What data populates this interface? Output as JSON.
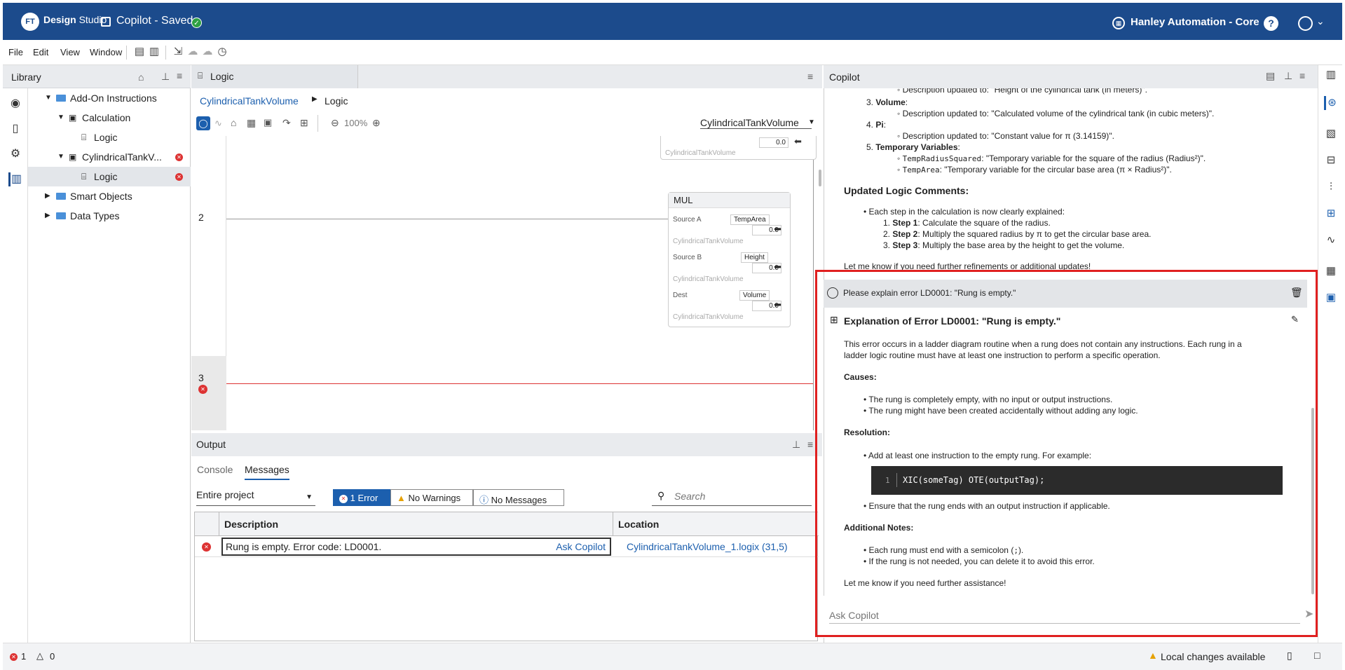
{
  "app": {
    "logo": "FT",
    "brand_bold": "Design",
    "brand_rest": " Studio",
    "project_title": "Copilot  - Saved",
    "org": "Hanley Automation - Core",
    "help": "?"
  },
  "menu": [
    "File",
    "Edit",
    "View",
    "Window"
  ],
  "library": {
    "title": "Library",
    "tree": [
      {
        "label": "Add-On Instructions"
      },
      {
        "label": "Calculation"
      },
      {
        "label": "Logic"
      },
      {
        "label": "CylindricalTankV..."
      },
      {
        "label": "Logic"
      },
      {
        "label": "Smart Objects"
      },
      {
        "label": "Data Types"
      }
    ]
  },
  "logic": {
    "tab": "Logic",
    "breadcrumb": [
      "CylindricalTankVolume",
      "Logic"
    ],
    "zoom": "100%",
    "routine_select": "CylindricalTankVolume",
    "rung_numbers": [
      "2",
      "3"
    ],
    "top_val": "0.0",
    "top_ghost": "CylindricalTankVolume",
    "mul": {
      "title": "MUL",
      "source_a_label": "Source A",
      "source_a_tag": "TempArea",
      "source_a_val": "0.0",
      "source_b_label": "Source B",
      "source_b_tag": "Height",
      "source_b_val": "0.0",
      "dest_label": "Dest",
      "dest_tag": "Volume",
      "dest_val": "0.0",
      "ghost": "CylindricalTankVolume"
    }
  },
  "output": {
    "title": "Output",
    "tabs": [
      "Console",
      "Messages"
    ],
    "scope": "Entire project",
    "errors": "1 Error",
    "warnings": "No Warnings",
    "messages": "No Messages",
    "search_placeholder": "Search",
    "columns": [
      "Description",
      "Location"
    ],
    "rows": [
      {
        "description": "Rung is empty. Error code: LD0001.",
        "action": "Ask Copilot",
        "location": "CylindricalTankVolume_1.logix (31,5)"
      }
    ]
  },
  "copilot": {
    "title": "Copilot",
    "prev": {
      "line0": "Description updated to: \"Height of the cylindrical tank (in meters)\".",
      "item3": "Volume",
      "item3_desc": "Description updated to: \"Calculated volume of the cylindrical tank (in cubic meters)\".",
      "item4": "Pi",
      "item4_desc": "Description updated to: \"Constant value for π (3.14159)\".",
      "item5": "Temporary Variables",
      "temp1_code": "TempRadiusSquared",
      "temp1_desc": ": \"Temporary variable for the square of the radius (Radius²)\".",
      "temp2_code": "TempArea",
      "temp2_desc": ": \"Temporary variable for the circular base area (π × Radius²)\".",
      "heading": "Updated Logic Comments:",
      "bullet": "Each step in the calculation is now clearly explained:",
      "step1_b": "Step 1",
      "step1": ": Calculate the square of the radius.",
      "step2_b": "Step 2",
      "step2": ": Multiply the squared radius by π to get the circular base area.",
      "step3_b": "Step 3",
      "step3": ": Multiply the base area by the height to get the volume.",
      "closing": "Let me know if you need further refinements or additional updates!"
    },
    "user_message": "Please explain error LD0001: \"Rung is empty.\"",
    "reply": {
      "heading": "Explanation of Error LD0001: \"Rung is empty.\"",
      "intro1": "This error occurs in a ladder diagram routine when a rung does not contain any instructions. Each rung in a",
      "intro2": "ladder logic routine must have at least one instruction to perform a specific operation.",
      "causes_h": "Causes:",
      "cause1": "The rung is completely empty, with no input or output instructions.",
      "cause2": "The rung might have been created accidentally without adding any logic.",
      "resolution_h": "Resolution:",
      "res1": "Add at least one instruction to the empty rung. For example:",
      "code_line_no": "1",
      "code": "XIC(someTag) OTE(outputTag);",
      "res2": "Ensure that the rung ends with an output instruction if applicable.",
      "notes_h": "Additional Notes:",
      "note1a": "Each rung must end with a semicolon (",
      "note1_code": ";",
      "note1b": ").",
      "note2": "If the rung is not needed, you can delete it to avoid this error.",
      "closing": "Let me know if you need further assistance!"
    },
    "input_placeholder": "Ask Copilot"
  },
  "status": {
    "errors": "1",
    "warnings": "0",
    "changes": "Local changes available"
  },
  "colors": {
    "brand": "#1c4b8c",
    "error": "#d33333",
    "highlight": "#e02020"
  }
}
